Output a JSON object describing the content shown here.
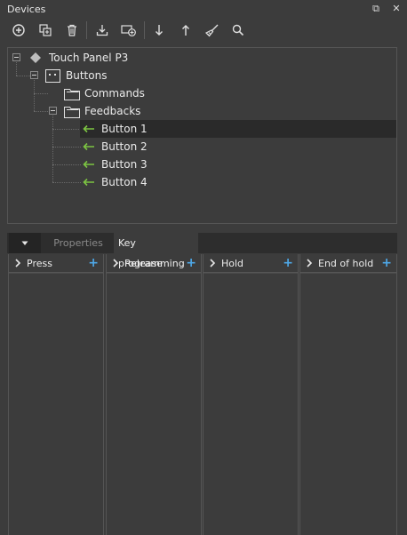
{
  "window": {
    "title": "Devices",
    "float_glyph": "⧉",
    "close_glyph": "✕"
  },
  "toolbar": {
    "icons": [
      "add-icon",
      "duplicate-icon",
      "delete-icon",
      "import-icon",
      "add-device-icon",
      "move-down-icon",
      "move-up-icon",
      "clear-icon",
      "search-icon"
    ]
  },
  "tree": {
    "root": {
      "label": "Touch Panel P3",
      "icon": "diamond-icon"
    },
    "buttons_group": {
      "label": "Buttons",
      "icon": "group-icon"
    },
    "commands": {
      "label": "Commands",
      "icon": "folder-icon"
    },
    "feedbacks": {
      "label": "Feedbacks",
      "icon": "folder-icon"
    },
    "items": [
      {
        "label": "Button 1",
        "selected": true
      },
      {
        "label": "Button 2",
        "selected": false
      },
      {
        "label": "Button 3",
        "selected": false
      },
      {
        "label": "Button 4",
        "selected": false
      }
    ]
  },
  "tabs": {
    "collapse_icon": "chevron-down-icon",
    "properties": "Properties",
    "key_programming": "Key programming",
    "active": "key_programming"
  },
  "columns": [
    {
      "label": "Press"
    },
    {
      "label": "Release"
    },
    {
      "label": "Hold"
    },
    {
      "label": "End of hold"
    }
  ],
  "colors": {
    "accent": "#4ea8e8",
    "arrow": "#7cc442",
    "background": "#3c3c3c"
  }
}
